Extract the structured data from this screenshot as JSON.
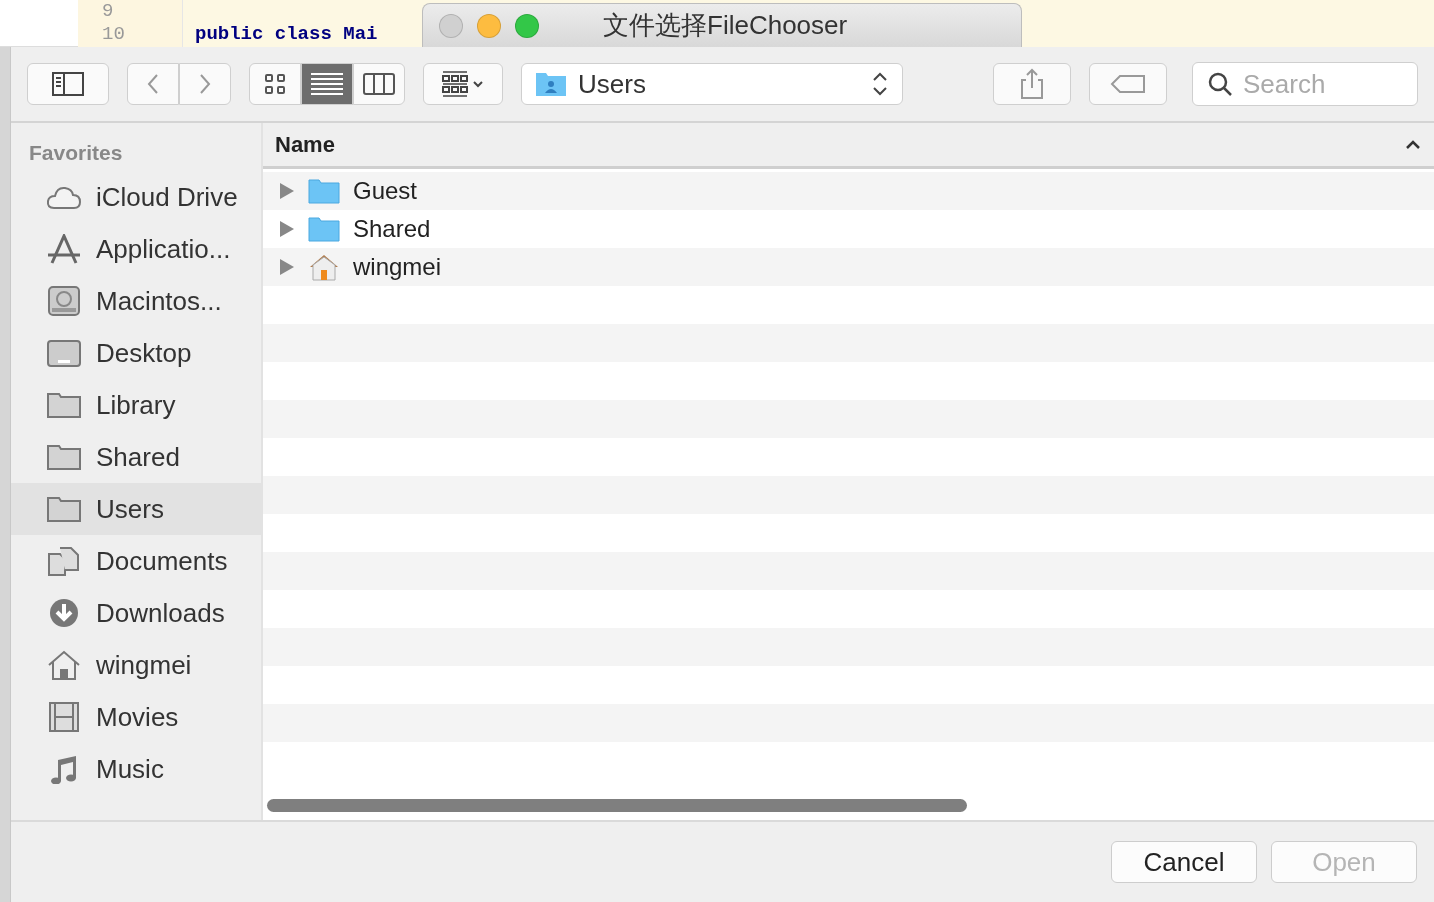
{
  "editor": {
    "lines": [
      {
        "number": "9"
      },
      {
        "number": "10",
        "code": "public class Mai"
      }
    ]
  },
  "window": {
    "title": "文件选择FileChooser"
  },
  "toolbar": {
    "view_modes": [
      {
        "kind": "icons",
        "selected": false
      },
      {
        "kind": "list",
        "selected": true
      },
      {
        "kind": "columns",
        "selected": false
      }
    ],
    "location": "Users",
    "search": {
      "placeholder": "Search"
    }
  },
  "sidebar": {
    "heading": "Favorites",
    "items": [
      {
        "label": "iCloud Drive",
        "kind": "cloud",
        "selected": false
      },
      {
        "label": "Applicatio...",
        "kind": "apps",
        "selected": false
      },
      {
        "label": "Macintos...",
        "kind": "disk",
        "selected": false
      },
      {
        "label": "Desktop",
        "kind": "desktop",
        "selected": false
      },
      {
        "label": "Library",
        "kind": "folder",
        "selected": false
      },
      {
        "label": "Shared",
        "kind": "folder",
        "selected": false
      },
      {
        "label": "Users",
        "kind": "folder",
        "selected": true
      },
      {
        "label": "Documents",
        "kind": "documents",
        "selected": false
      },
      {
        "label": "Downloads",
        "kind": "download",
        "selected": false
      },
      {
        "label": "wingmei",
        "kind": "home",
        "selected": false
      },
      {
        "label": "Movies",
        "kind": "film",
        "selected": false
      },
      {
        "label": "Music",
        "kind": "music",
        "selected": false
      }
    ]
  },
  "table": {
    "columns": [
      "Name"
    ],
    "rows": [
      {
        "name": "Guest",
        "kind": "folder",
        "expanded": false
      },
      {
        "name": "Shared",
        "kind": "folder",
        "expanded": false
      },
      {
        "name": "wingmei",
        "kind": "home",
        "expanded": false
      }
    ]
  },
  "buttons": [
    {
      "label": "Cancel",
      "disabled": false
    },
    {
      "label": "Open",
      "disabled": true
    }
  ]
}
